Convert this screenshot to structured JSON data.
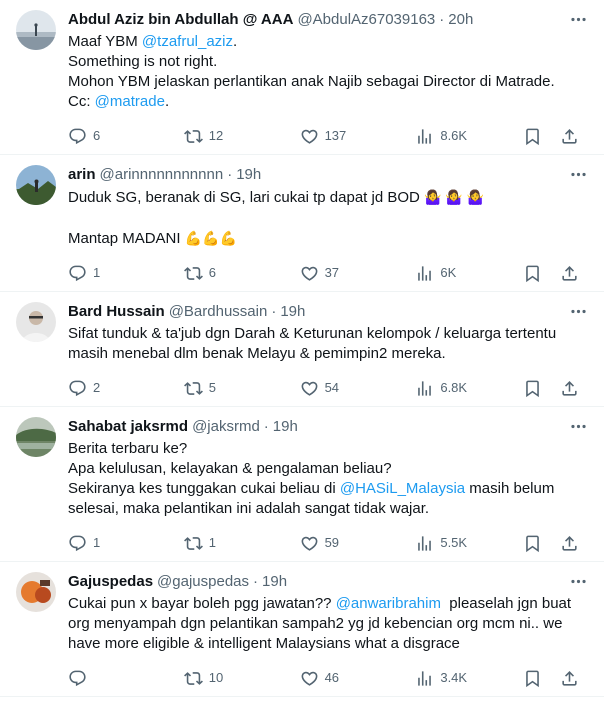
{
  "tweets": [
    {
      "name": "Abdul Aziz bin Abdullah @ AAA",
      "handle": "@AbdulAz67039163",
      "time": "20h",
      "lines": [
        [
          {
            "t": "Maaf YBM "
          },
          {
            "t": "@tzafrul_aziz",
            "link": true
          },
          {
            "t": "."
          }
        ],
        [
          {
            "t": "Something is not right."
          }
        ],
        [
          {
            "t": "Mohon YBM jelaskan perlantikan anak Najib sebagai Director di Matrade."
          }
        ],
        [
          {
            "t": "Cc: "
          },
          {
            "t": "@matrade",
            "link": true
          },
          {
            "t": "."
          }
        ]
      ],
      "replies": "6",
      "reposts": "12",
      "likes": "137",
      "views": "8.6K",
      "avatar": "landscape"
    },
    {
      "name": "arin",
      "handle": "@arinnnnnnnnnnn",
      "time": "19h",
      "lines": [
        [
          {
            "t": "Duduk SG, beranak di SG, lari cukai tp dapat jd BOD "
          },
          {
            "t": "🤷‍♀️ 🤷‍♀️ 🤷‍♀️",
            "emoji": true
          }
        ],
        [
          {
            "t": " "
          }
        ],
        [
          {
            "t": "Mantap MADANI "
          },
          {
            "t": "💪💪💪",
            "emoji": true
          }
        ]
      ],
      "replies": "1",
      "reposts": "6",
      "likes": "37",
      "views": "6K",
      "avatar": "hiker"
    },
    {
      "name": "Bard Hussain",
      "handle": "@Bardhussain",
      "time": "19h",
      "lines": [
        [
          {
            "t": "Sifat tunduk & ta'jub dgn Darah & Keturunan kelompok / keluarga tertentu"
          }
        ],
        [
          {
            "t": "masih menebal dlm benak Melayu & pemimpin2 mereka."
          }
        ]
      ],
      "replies": "2",
      "reposts": "5",
      "likes": "54",
      "views": "6.8K",
      "avatar": "man"
    },
    {
      "name": "Sahabat jaksrmd",
      "handle": "@jaksrmd",
      "time": "19h",
      "lines": [
        [
          {
            "t": "Berita terbaru ke?"
          }
        ],
        [
          {
            "t": "Apa kelulusan, kelayakan & pengalaman beliau?"
          }
        ],
        [
          {
            "t": "Sekiranya kes tunggakan cukai beliau di "
          },
          {
            "t": "@HASiL_Malaysia",
            "link": true
          },
          {
            "t": " masih belum"
          }
        ],
        [
          {
            "t": "selesai, maka pelantikan ini adalah sangat tidak wajar."
          }
        ]
      ],
      "replies": "1",
      "reposts": "1",
      "likes": "59",
      "views": "5.5K",
      "avatar": "lake"
    },
    {
      "name": "Gajuspedas",
      "handle": "@gajuspedas",
      "time": "19h",
      "lines": [
        [
          {
            "t": "Cukai pun x bayar boleh pgg jawatan?? "
          },
          {
            "t": "@anwaribrahim",
            "link": true
          },
          {
            "t": "  pleaselah jgn buat"
          }
        ],
        [
          {
            "t": "org menyampah dgn pelantikan sampah2 yg jd kebencian org mcm ni.. we"
          }
        ],
        [
          {
            "t": "have more eligible & intelligent Malaysians what a disgrace"
          }
        ]
      ],
      "replies": "",
      "reposts": "10",
      "likes": "46",
      "views": "3.4K",
      "avatar": "orange"
    }
  ],
  "separator": "·",
  "icons": {
    "reply": "reply-icon",
    "repost": "repost-icon",
    "like": "heart-icon",
    "views": "views-icon",
    "bookmark": "bookmark-icon",
    "share": "share-icon",
    "more": "more-icon"
  },
  "colors": {
    "link": "#1d9bf0",
    "muted": "#536471",
    "text": "#0f1419",
    "divider": "#eff3f4"
  }
}
